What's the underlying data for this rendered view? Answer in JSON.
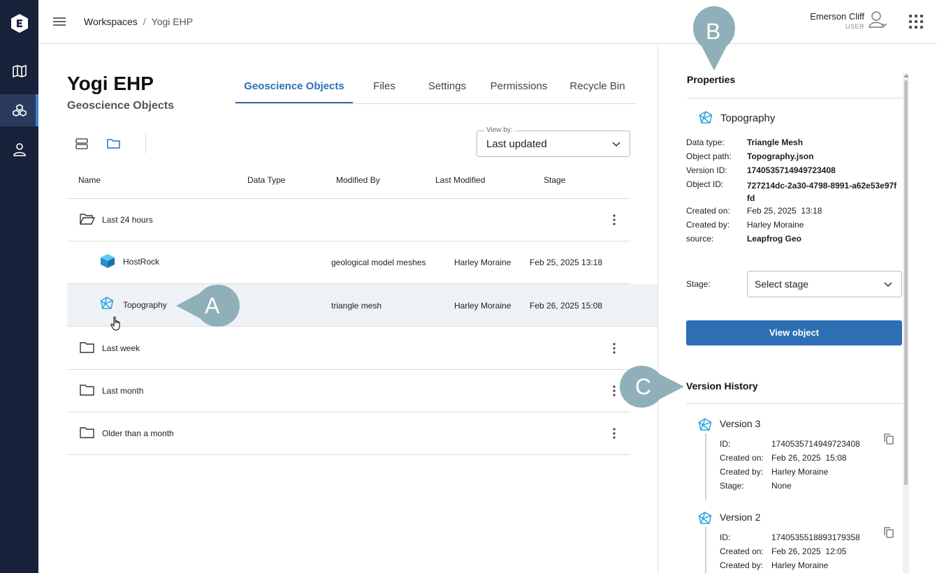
{
  "breadcrumb": {
    "workspaces": "Workspaces",
    "separator": "/",
    "current": "Yogi EHP"
  },
  "user": {
    "name": "Emerson Cliff",
    "role": "USER"
  },
  "page": {
    "title": "Yogi EHP",
    "subtitle": "Geoscience Objects"
  },
  "tabs": [
    {
      "label": "Geoscience Objects",
      "active": true
    },
    {
      "label": "Files"
    },
    {
      "label": "Settings"
    },
    {
      "label": "Permissions"
    },
    {
      "label": "Recycle Bin"
    }
  ],
  "view_by": {
    "label": "View by:",
    "value": "Last updated"
  },
  "table": {
    "columns": [
      "Name",
      "Data Type",
      "Modified By",
      "Last Modified",
      "Stage"
    ],
    "rows": [
      {
        "type": "group",
        "name": "Last 24 hours",
        "open": true
      },
      {
        "type": "object",
        "name": "HostRock",
        "data_type": "geological model meshes",
        "modified_by": "Harley Moraine",
        "last_modified": "Feb 25, 2025  13:18"
      },
      {
        "type": "object",
        "name": "Topography",
        "data_type": "triangle mesh",
        "modified_by": "Harley Moraine",
        "last_modified": "Feb 26, 2025  15:08",
        "selected": true
      },
      {
        "type": "group",
        "name": "Last week"
      },
      {
        "type": "group",
        "name": "Last month"
      },
      {
        "type": "group",
        "name": "Older than a month"
      }
    ]
  },
  "callouts": {
    "a": "A",
    "b": "B",
    "c": "C"
  },
  "properties": {
    "title": "Properties",
    "object_name": "Topography",
    "fields": [
      {
        "key": "Data type:",
        "value": "Triangle Mesh",
        "bold": true
      },
      {
        "key": "Object path:",
        "value": "Topography.json",
        "bold": true
      },
      {
        "key": "Version ID:",
        "value": "1740535714949723408",
        "bold": true
      },
      {
        "key": "Object ID:",
        "value": "727214dc-2a30-4798-8991-a62e53e97ffd",
        "bold": true
      },
      {
        "key": "Created on:",
        "value": "Feb 25, 2025  13:18",
        "bold": false
      },
      {
        "key": "Created by:",
        "value": "Harley Moraine",
        "bold": false
      },
      {
        "key": "source:",
        "value": "Leapfrog Geo",
        "bold": true
      }
    ],
    "stage_label": "Stage:",
    "stage_placeholder": "Select stage",
    "view_button": "View object"
  },
  "version_history": {
    "title": "Version History",
    "versions": [
      {
        "name": "Version 3",
        "id_label": "ID:",
        "id": "1740535714949723408",
        "created_on_label": "Created on:",
        "created_on": "Feb 26, 2025  15:08",
        "created_by_label": "Created by:",
        "created_by": "Harley Moraine",
        "stage_label": "Stage:",
        "stage": "None"
      },
      {
        "name": "Version 2",
        "id_label": "ID:",
        "id": "1740535518893179358",
        "created_on_label": "Created on:",
        "created_on": "Feb 26, 2025  12:05",
        "created_by_label": "Created by:",
        "created_by": "Harley Moraine"
      }
    ]
  },
  "colors": {
    "rail": "#17213a",
    "accent": "#2d6fb5",
    "callout": "#8fb0b8",
    "icon_blue": "#2aa3e0"
  }
}
